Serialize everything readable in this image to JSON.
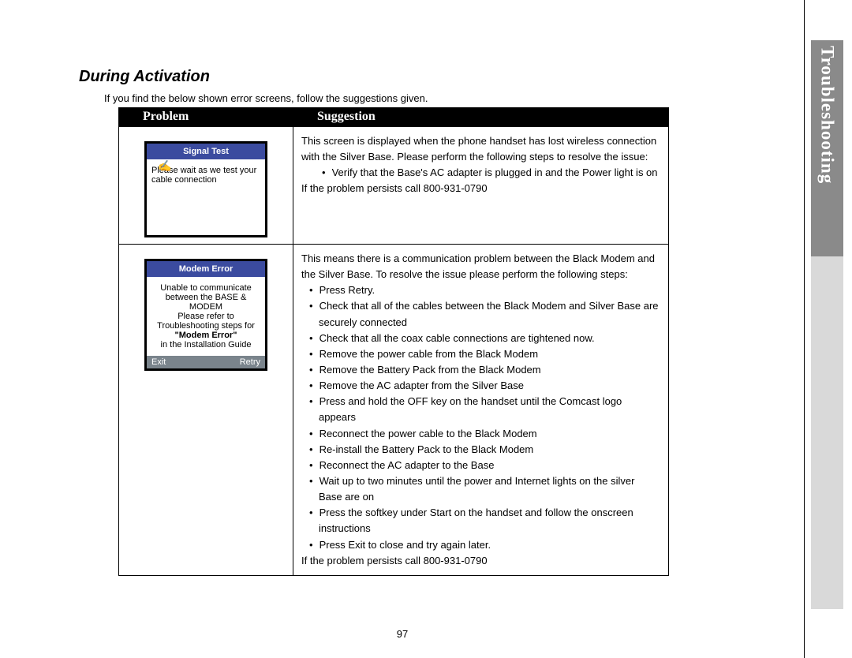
{
  "sideTab": "Troubleshooting",
  "section": "During Activation",
  "noteLine": "If you find the below shown error screens, follow the suggestions given.",
  "headers": {
    "problem": "Problem",
    "suggestion": "Suggestion"
  },
  "rows": [
    {
      "phone": {
        "title": "Signal Test",
        "body": "Please wait as we test your cable connection",
        "footLeft": "",
        "footRight": ""
      },
      "suggestion": {
        "intro": "This screen is displayed when the phone handset has lost wireless connection with the Silver Base. Please perform the following steps to resolve the issue:",
        "bullets": [
          "Verify that the Base's AC adapter is plugged in and the Power light is on"
        ],
        "persist": "If the problem persists call 800-931-0790"
      }
    },
    {
      "phone": {
        "title": "Modem Error",
        "body": "Unable to communicate between the BASE & MODEM\nPlease refer to Troubleshooting steps for \"Modem Error\" in the Installation Guide",
        "footLeft": "Exit",
        "footRight": "Retry"
      },
      "suggestion": {
        "intro": "This means there is a communication problem between the Black Modem and the Silver Base. To resolve the issue please perform the following steps:",
        "bullets": [
          "Press Retry.",
          "Check that all of the cables between the Black Modem and Silver Base are securely connected",
          "Check that all the coax cable connections are tightened now.",
          "Remove the power cable from the Black Modem",
          "Remove the Battery Pack from the Black Modem",
          "Remove the AC adapter from the Silver Base",
          "Press and hold the OFF key on the handset until the Comcast logo appears",
          "Reconnect the power cable to the Black Modem",
          "Re-install the Battery Pack to the Black Modem",
          "Reconnect the AC adapter to the Base",
          "Wait up to two minutes until the power and Internet lights on the silver Base are on",
          "Press the softkey under Start on the handset and follow the onscreen instructions",
          "Press Exit to close and try again later."
        ],
        "persist": "If the problem persists call 800-931-0790"
      }
    }
  ],
  "pageNumber": "97"
}
